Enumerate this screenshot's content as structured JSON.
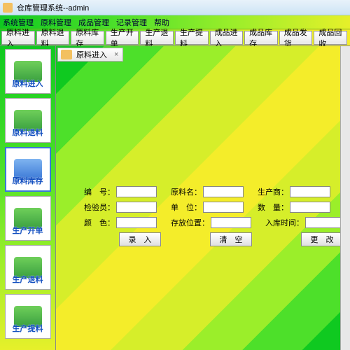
{
  "window": {
    "title": "仓库管理系统--admin"
  },
  "menu": [
    "系统管理",
    "原料管理",
    "成品管理",
    "记录管理",
    "帮助"
  ],
  "toolbar": [
    "原料进入",
    "原料退料",
    "原料库存",
    "生产开单",
    "生产退料",
    "生产提料",
    "成品进入",
    "成品库存",
    "成品发货",
    "成品回收"
  ],
  "sidebar": [
    {
      "label": "原料进入",
      "color": "green",
      "sel": false
    },
    {
      "label": "原料退料",
      "color": "green",
      "sel": false
    },
    {
      "label": "原料库存",
      "color": "blue",
      "sel": true
    },
    {
      "label": "生产开单",
      "color": "green",
      "sel": false
    },
    {
      "label": "生产退料",
      "color": "green",
      "sel": false
    },
    {
      "label": "生产提料",
      "color": "green",
      "sel": false
    }
  ],
  "tab": {
    "label": "原料进入",
    "close": "×"
  },
  "form": {
    "rows": [
      [
        {
          "label": "编　号：",
          "value": ""
        },
        {
          "label": "原料名：",
          "value": ""
        },
        {
          "label": "生产商：",
          "value": ""
        }
      ],
      [
        {
          "label": "检验员：",
          "value": ""
        },
        {
          "label": "单　位：",
          "value": ""
        },
        {
          "label": "数　量：",
          "value": ""
        }
      ],
      [
        {
          "label": "颜　色：",
          "value": ""
        },
        {
          "label": "存放位置：",
          "value": ""
        },
        {
          "label": "入库时间：",
          "value": ""
        }
      ]
    ],
    "buttons": [
      "录　入",
      "清　空",
      "更　改"
    ]
  }
}
